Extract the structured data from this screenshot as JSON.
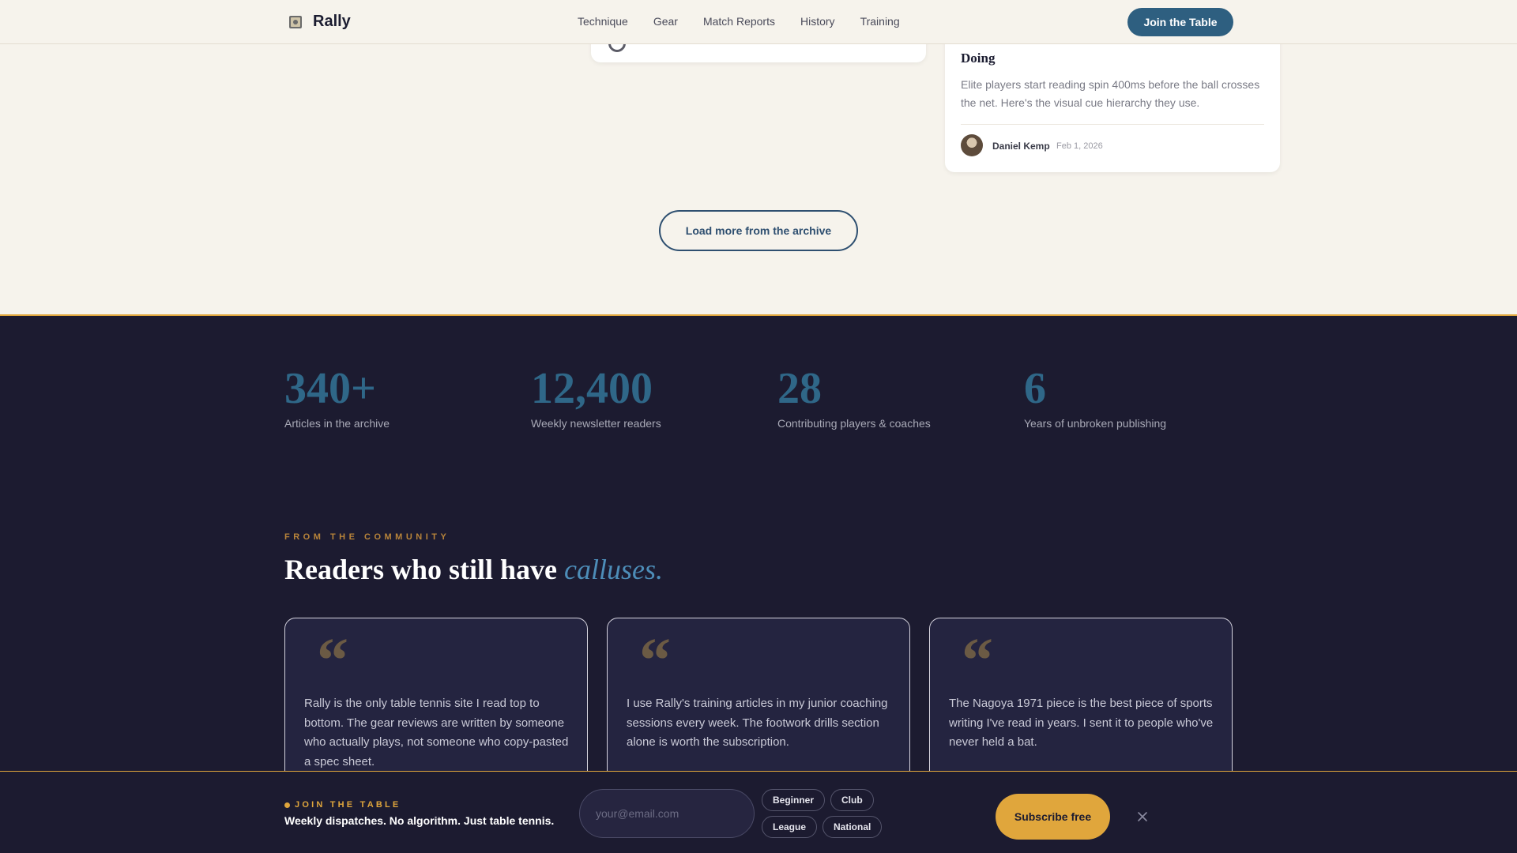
{
  "header": {
    "logo_text": "Rally",
    "nav": [
      "Technique",
      "Gear",
      "Match Reports",
      "History",
      "Training"
    ],
    "cta": "Join the Table"
  },
  "archive": {
    "card": {
      "title_visible": "Doing",
      "excerpt": "Elite players start reading spin 400ms before the ball crosses the net. Here's the visual cue hierarchy they use.",
      "author": "Daniel Kemp",
      "date": "Feb 1, 2026"
    },
    "load_more": "Load more from the archive"
  },
  "stats": [
    {
      "value": "340+",
      "label": "Articles in the archive"
    },
    {
      "value": "12,400",
      "label": "Weekly newsletter readers"
    },
    {
      "value": "28",
      "label": "Contributing players & coaches"
    },
    {
      "value": "6",
      "label": "Years of unbroken publishing"
    }
  ],
  "community": {
    "eyebrow": "FROM THE COMMUNITY",
    "heading": "Readers who still have",
    "heading_accent": "calluses.",
    "quote_mark": "“",
    "testimonials": [
      {
        "text": "Rally is the only table tennis site I read top to bottom. The gear reviews are written by someone who actually plays, not someone who copy-pasted a spec sheet."
      },
      {
        "text": "I use Rally's training articles in my junior coaching sessions every week. The footwork drills section alone is worth the subscription."
      },
      {
        "text": "The Nagoya 1971 piece is the best piece of sports writing I've read in years. I sent it to people who've never held a bat."
      }
    ]
  },
  "subscribe_bar": {
    "eyebrow": "JOIN THE TABLE",
    "tagline": "Weekly dispatches. No algorithm. Just table tennis.",
    "email_placeholder": "your@email.com",
    "levels": [
      "Beginner",
      "Club",
      "League",
      "National"
    ],
    "submit": "Subscribe free"
  },
  "colors": {
    "accent": "#2e5f80",
    "gold": "#e0a63c",
    "dark_bg": "#1c1b30",
    "light_bg": "#f6f3ec"
  }
}
